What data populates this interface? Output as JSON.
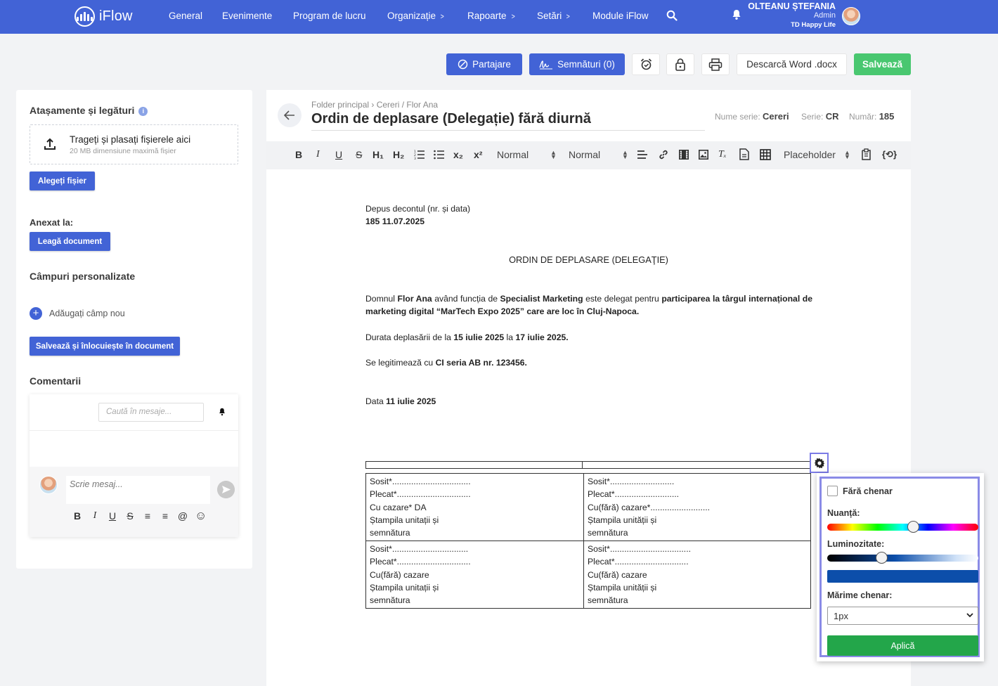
{
  "nav": {
    "logo": "iFlow",
    "items": [
      {
        "label": "General",
        "chevron": false
      },
      {
        "label": "Evenimente",
        "chevron": false
      },
      {
        "label": "Program de lucru",
        "chevron": false
      },
      {
        "label": "Organizație",
        "chevron": true
      },
      {
        "label": "Rapoarte",
        "chevron": true
      },
      {
        "label": "Setări",
        "chevron": true
      },
      {
        "label": "Module iFlow",
        "chevron": false
      }
    ],
    "chevron_glyph": ">",
    "user": {
      "name": "OLTEANU ȘTEFANIA",
      "role": "Admin",
      "company": "TD Happy Life"
    }
  },
  "toolbar": {
    "share": "Partajare",
    "signatures": "Semnături (0)",
    "download": "Descarcă Word .docx",
    "save": "Salvează"
  },
  "left": {
    "attachments_title": "Atașamente și legături",
    "info": "i",
    "dropzone_title": "Trageți și plasați fișierele aici",
    "dropzone_sub": "20 MB dimensiune maximă fișier",
    "choose_file": "Alegeți fișier",
    "annexed_title": "Anexat la:",
    "link_document": "Leagă document",
    "custom_fields_title": "Câmpuri personalizate",
    "add_field": "Adăugați câmp nou",
    "plus": "+",
    "save_replace": "Salvează și înlocuiește în document",
    "comments_title": "Comentarii",
    "search_placeholder": "Caută în mesaje...",
    "message_placeholder": "Scrie mesaj...",
    "comment_tools": [
      "B",
      "I",
      "U",
      "S",
      "≡",
      "≡",
      "@",
      "☺"
    ]
  },
  "editor": {
    "breadcrumb": "Folder principal  ›  Cereri / Flor Ana",
    "title": "Ordin de deplasare (Delegație) fără diurnă",
    "series_name_label": "Nume serie:",
    "series_name": "Cereri",
    "series_label": "Serie:",
    "series": "CR",
    "number_label": "Număr:",
    "number": "185",
    "format_select_1": "Normal",
    "format_select_2": "Normal",
    "placeholder_select": "Placeholder",
    "tools": {
      "bold": "B",
      "italic": "I",
      "underline": "U",
      "strike": "S",
      "h1": "H₁",
      "h2": "H₂",
      "sub": "x₂",
      "sup": "x²",
      "clear": "Tₓ",
      "braces": "{⟲}"
    }
  },
  "document": {
    "decont_label": "Depus decontul (nr. și data)",
    "decont_value": "185 11.07.2025",
    "heading": "ORDIN DE DEPLASARE (DELEGAŢIE)",
    "p1": {
      "a": "Domnul ",
      "name": "Flor Ana",
      "b": " având funcția de ",
      "role": "Specialist Marketing",
      "c": " este delegat pentru ",
      "purpose": "participarea la târgul internațional de marketing digital “MarTech Expo 2025” care are loc în Cluj-Napoca."
    },
    "p2": {
      "a": "Durata deplasării de la ",
      "from": "15 iulie 2025",
      "b": " la ",
      "to": "17 iulie 2025."
    },
    "p3": {
      "a": "Se legitimează cu ",
      "id": "CI seria AB nr. 123456."
    },
    "p4": {
      "a": "Data ",
      "date": "11 iulie 2025"
    },
    "table": [
      [
        [
          "Sosit*.................................",
          "Plecat*...............................",
          "Cu cazare*  DA",
          "Ștampila unitații și",
          "semnătura"
        ],
        [
          "Sosit*...........................",
          "Plecat*...........................",
          "Cu(fără) cazare*.........................",
          "Ștampila unității și",
          "semnătura"
        ]
      ],
      [
        [
          "Sosit*................................",
          "Plecat*...............................",
          "Cu(fără) cazare",
          "Ștampila unitații și",
          "semnătura"
        ],
        [
          "Sosit*..................................",
          "Plecat*...............................",
          "Cu(fără) cazare",
          "Ștampila unității și",
          "semnătura"
        ]
      ]
    ]
  },
  "border_popup": {
    "no_border": "Fără chenar",
    "hue": "Nuanță:",
    "hue_value": 0.57,
    "brightness": "Luminozitate:",
    "brightness_value": 0.36,
    "selected_color": "#0c4eaa",
    "border_size_label": "Mărime chenar:",
    "border_size": "1px",
    "apply": "Aplică"
  },
  "colors": {
    "primary": "#4263d6",
    "save": "#49c770",
    "apply": "#23a64a",
    "popup_border": "#8a8be6"
  }
}
